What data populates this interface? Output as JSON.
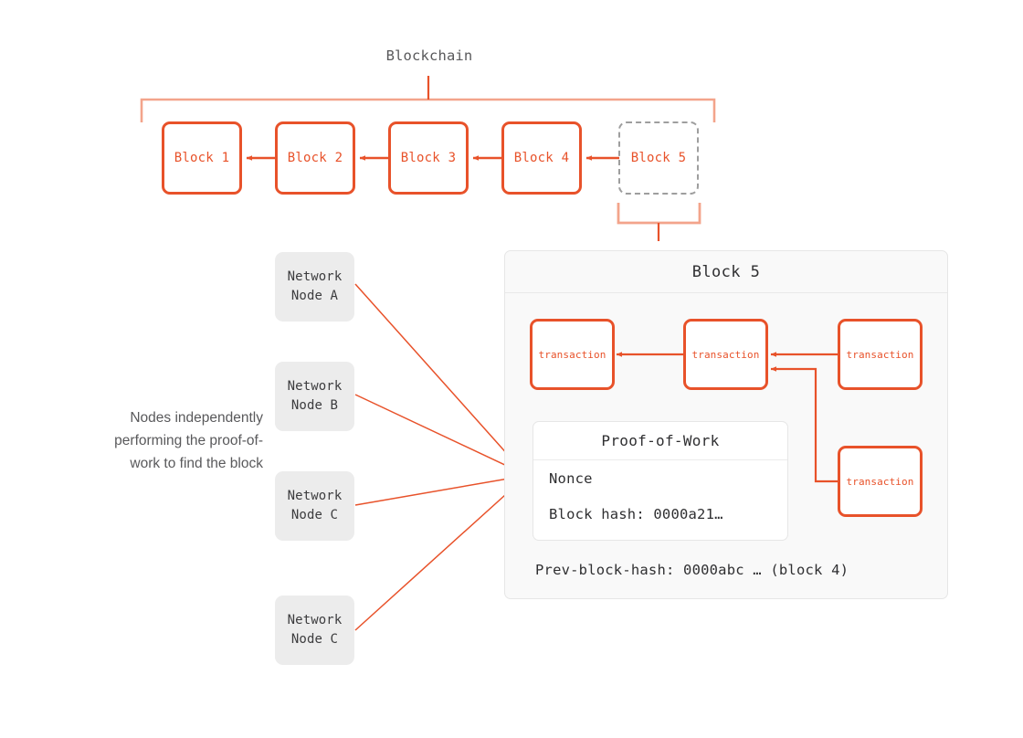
{
  "diagram": {
    "title_label": "Blockchain",
    "caption": "Nodes independently performing the proof-of-work to find the block",
    "accent_color": "#e8522a",
    "accent_light_color": "#f3a48b",
    "pending_border_color": "#9e9e9e",
    "node_bg_color": "#ececec",
    "panel_bg_color": "#f9f9f9",
    "text_color": "#2f2f31",
    "muted_text_color": "#59595b"
  },
  "chain": {
    "blocks": [
      {
        "label": "Block 1",
        "state": "confirmed"
      },
      {
        "label": "Block 2",
        "state": "confirmed"
      },
      {
        "label": "Block 3",
        "state": "confirmed"
      },
      {
        "label": "Block 4",
        "state": "confirmed"
      },
      {
        "label": "Block 5",
        "state": "pending"
      }
    ]
  },
  "nodes": [
    {
      "line1": "Network",
      "line2": "Node A"
    },
    {
      "line1": "Network",
      "line2": "Node B"
    },
    {
      "line1": "Network",
      "line2": "Node C"
    },
    {
      "line1": "Network",
      "line2": "Node C"
    }
  ],
  "block_detail": {
    "title": "Block 5",
    "transactions": [
      {
        "label": "transaction"
      },
      {
        "label": "transaction"
      },
      {
        "label": "transaction"
      },
      {
        "label": "transaction"
      }
    ],
    "proof_of_work": {
      "title": "Proof-of-Work",
      "nonce_label": "Nonce",
      "block_hash_label": "Block hash: 0000a21…"
    },
    "prev_block_hash_label": "Prev-block-hash: 0000abc … (block 4)"
  }
}
